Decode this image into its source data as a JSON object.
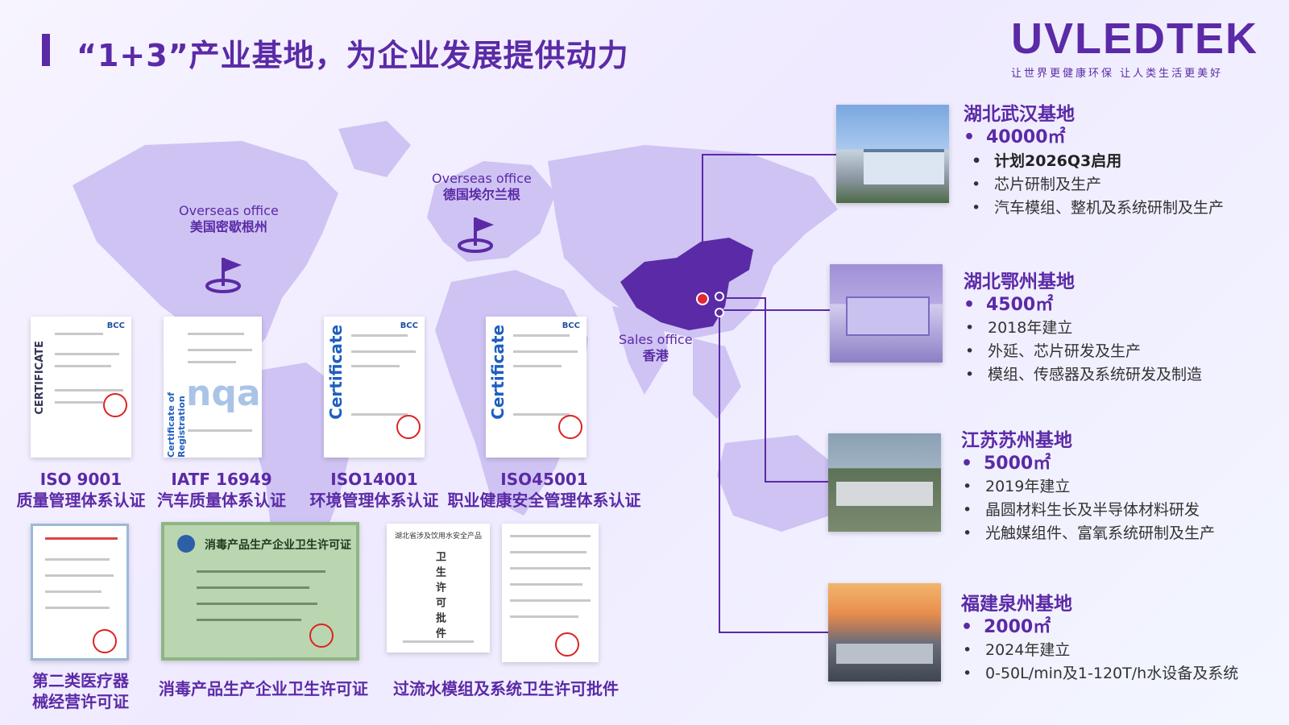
{
  "header": {
    "title": "“1+3”产业基地，为企业发展提供动力",
    "logo_text": "UVLEDTEK",
    "logo_slogan": "让世界更健康环保 让人类生活更美好"
  },
  "offices": [
    {
      "en": "Overseas office",
      "cn": "美国密歇根州"
    },
    {
      "en": "Overseas office",
      "cn": "德国埃尔兰根"
    },
    {
      "en": "Sales office",
      "cn": "香港"
    }
  ],
  "certs": [
    {
      "code": "ISO 9001",
      "name": "质量管理体系认证",
      "vert": "CERTIFICATE",
      "brand": "BCC"
    },
    {
      "code": "IATF 16949",
      "name": "汽车质量体系认证",
      "vert": "Certificate of Registration",
      "brand": "nqa"
    },
    {
      "code": "ISO14001",
      "name": "环境管理体系认证",
      "vert": "Certificate",
      "brand": "BCC"
    },
    {
      "code": "ISO45001",
      "name": "职业健康安全管理体系认证",
      "vert": "Certificate",
      "brand": "BCC"
    }
  ],
  "licenses": [
    {
      "name": "第二类医疗器械经营许可证",
      "name_line1": "第二类医疗器",
      "name_line2": "械经营许可证"
    },
    {
      "name": "消毒产品生产企业卫生许可证",
      "doc_title": "消毒产品生产企业卫生许可证"
    },
    {
      "name": "过流水模组及系统卫生许可批件",
      "doc_header": "湖北省涉及饮用水安全产品",
      "doc_vert": "卫生许可批件"
    }
  ],
  "bases": [
    {
      "name": "湖北武汉基地",
      "area": "40000㎡",
      "items": [
        "计划2026Q3启用",
        "芯片研制及生产",
        "汽车模组、整机及系统研制及生产"
      ]
    },
    {
      "name": "湖北鄂州基地",
      "area": "4500㎡",
      "items": [
        "2018年建立",
        "外延、芯片研发及生产",
        "模组、传感器及系统研发及制造"
      ]
    },
    {
      "name": "江苏苏州基地",
      "area": "5000㎡",
      "items": [
        "2019年建立",
        "晶圆材料生长及半导体材料研发",
        "光触媒组件、富氧系统研制及生产"
      ]
    },
    {
      "name": "福建泉州基地",
      "area": "2000㎡",
      "items": [
        "2024年建立",
        "0-50L/min及1-120T/h水设备及系统"
      ]
    }
  ],
  "colors": {
    "brand": "#5b2aa6",
    "map": "#cfc3f3",
    "china": "#5b2aa6",
    "marker": "#e0283a"
  }
}
